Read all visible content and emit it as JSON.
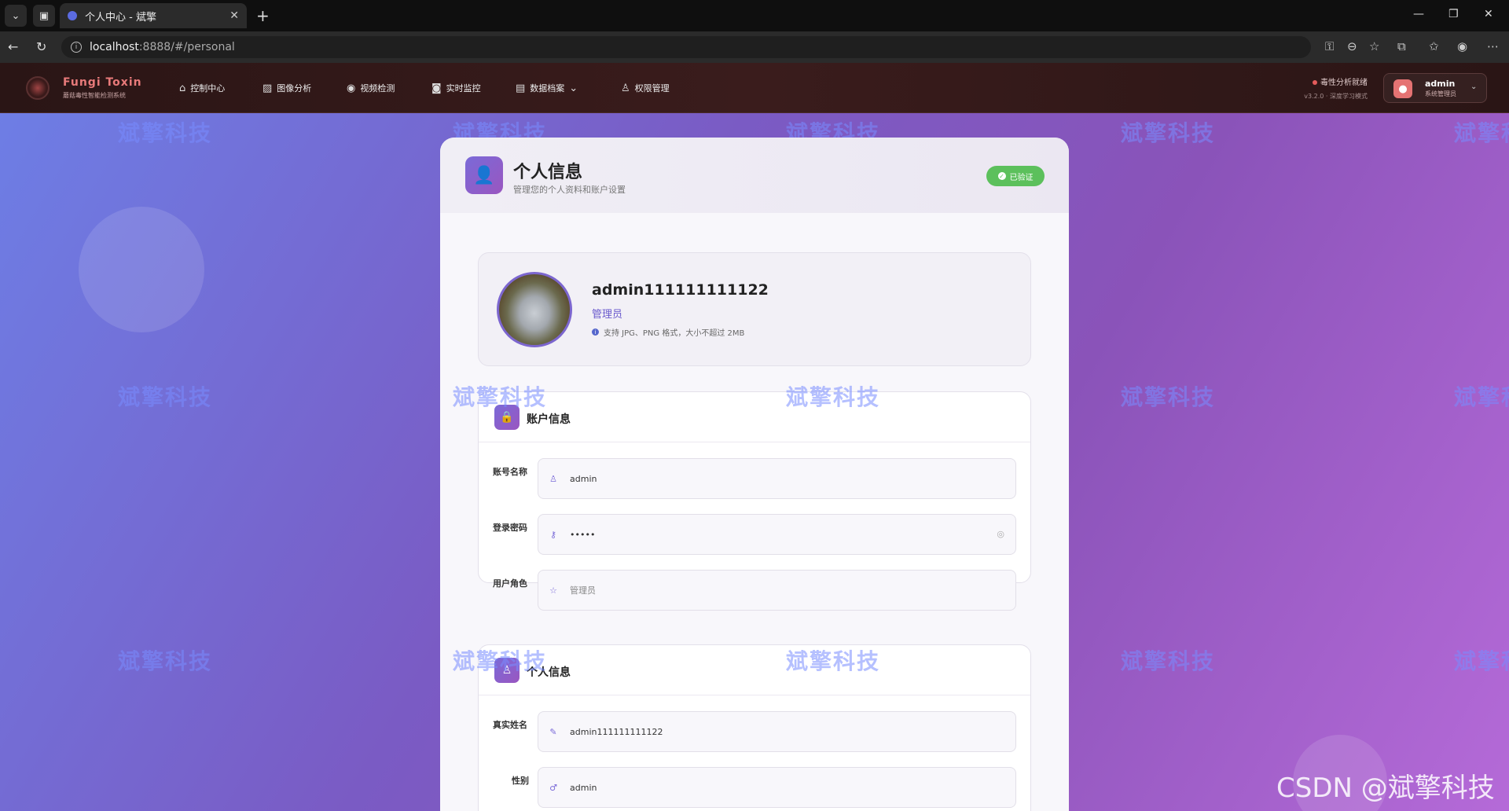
{
  "browser": {
    "tab_title": "个人中心 - 斌擎",
    "url_host": "localhost",
    "url_path": ":8888/#/personal"
  },
  "app": {
    "logo_title": "Fungi Toxin",
    "logo_subtitle": "蘑菇毒性智能检测系统",
    "nav": [
      {
        "icon": "home-icon",
        "label": "控制中心"
      },
      {
        "icon": "image-icon",
        "label": "图像分析"
      },
      {
        "icon": "play-icon",
        "label": "视频检测"
      },
      {
        "icon": "camera-icon",
        "label": "实时监控"
      },
      {
        "icon": "document-icon",
        "label": "数据档案"
      },
      {
        "icon": "user-icon",
        "label": "权限管理"
      }
    ],
    "status_text": "毒性分析就绪",
    "version_text": "v3.2.0 · 深度学习模式",
    "user_name": "admin",
    "user_role": "系统管理员"
  },
  "card": {
    "title": "个人信息",
    "subtitle": "管理您的个人资料和账户设置",
    "verified_label": "已验证",
    "profile_name": "admin111111111122",
    "profile_role": "管理员",
    "upload_hint": "支持 JPG、PNG 格式，大小不超过 2MB"
  },
  "account_section": {
    "title": "账户信息",
    "fields": [
      {
        "label": "账号名称",
        "value": "admin",
        "icon": "user-icon"
      },
      {
        "label": "登录密码",
        "value": "•••••",
        "icon": "key-icon"
      },
      {
        "label": "用户角色",
        "value": "管理员",
        "icon": "star-icon"
      }
    ]
  },
  "personal_section": {
    "title": "个人信息",
    "fields": [
      {
        "label": "真实姓名",
        "value": "admin111111111122",
        "icon": "edit-icon"
      },
      {
        "label": "性别",
        "value": "admin",
        "icon": "gender-icon"
      }
    ]
  },
  "watermark": "斌擎科技",
  "csdn_watermark": "CSDN @斌擎科技"
}
